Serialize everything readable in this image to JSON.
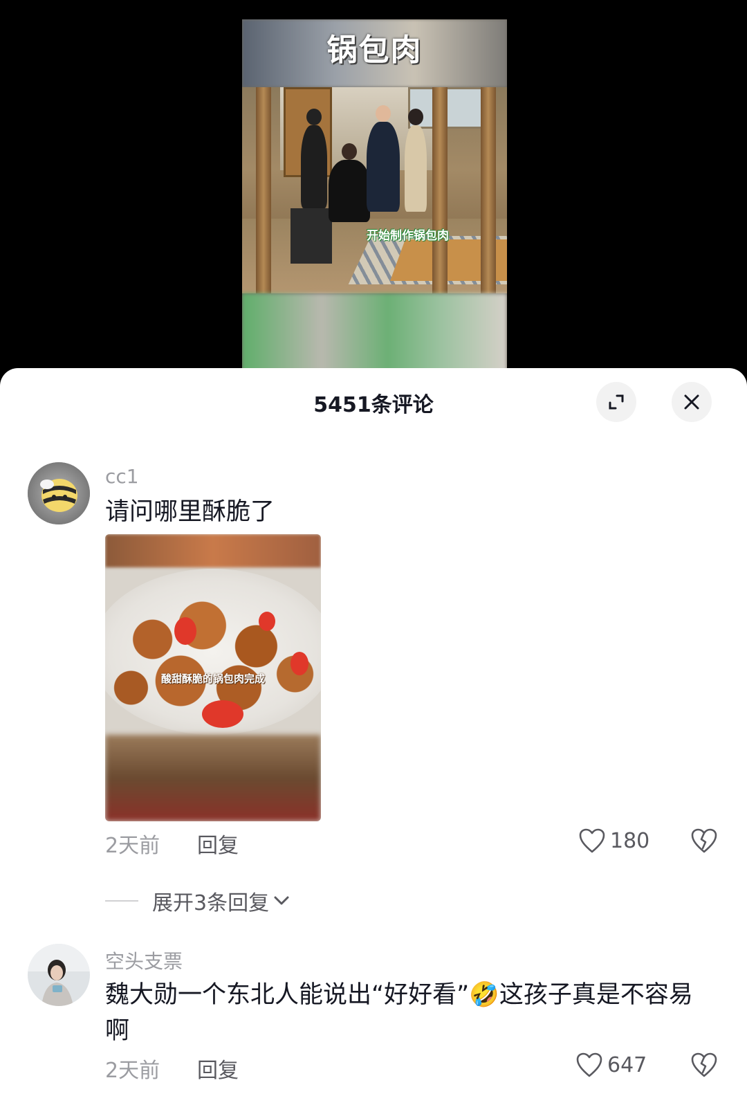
{
  "video": {
    "title": "锅包肉",
    "caption": "开始制作锅包肉"
  },
  "comments_panel": {
    "title": "5451条评论",
    "expand_icon": "expand-icon",
    "close_icon": "close-icon"
  },
  "comments": [
    {
      "username": "cc1",
      "text": "请问哪里酥脆了",
      "image_caption": "酸甜酥脆的锅包肉完成",
      "time": "2天前",
      "reply_label": "回复",
      "likes": "180",
      "expand_replies": "展开3条回复"
    },
    {
      "username": "空头支票",
      "text": "魏大勋一个东北人能说出“好好看”🤣这孩子真是不容易啊",
      "time": "2天前",
      "reply_label": "回复",
      "likes": "647"
    }
  ],
  "colors": {
    "text_primary": "#161823",
    "text_secondary": "#9b9ca1",
    "text_meta": "#59595f",
    "sheet_bg": "#ffffff",
    "button_bg": "#f2f2f2"
  }
}
